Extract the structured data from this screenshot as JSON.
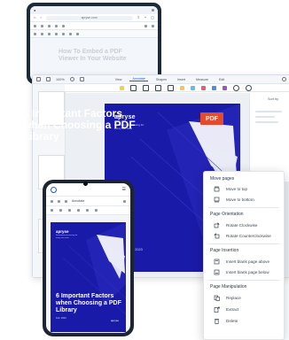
{
  "tablet": {
    "url": "apryse.com",
    "heading": "How To Embed a PDF Viewer In Your Website"
  },
  "desktop": {
    "zoom": "100%",
    "tabs": [
      "View",
      "Annotate",
      "Shapes",
      "Insert",
      "Measure",
      "Edit"
    ],
    "active_tab": "Annotate",
    "sort_label": "Sort by"
  },
  "pdf": {
    "logo": "apryse",
    "subtitle": "Document processing for every use case",
    "title": "6 Important Factors when Choosing a PDF Library",
    "badge": "PDF",
    "date": "May 2023"
  },
  "phone": {
    "url": "Annotate",
    "logo": "apryse",
    "subtitle": "Document processing for every use case",
    "title": "6 Important Factors when Choosing a PDF Library",
    "date": "Feb. 2023",
    "mark": "apryse"
  },
  "context_menu": {
    "sections": [
      {
        "title": "Move pages",
        "items": [
          {
            "label": "Move to top",
            "icon": "move-top-icon"
          },
          {
            "label": "Move to bottom",
            "icon": "move-bottom-icon"
          }
        ]
      },
      {
        "title": "Page Orientation",
        "items": [
          {
            "label": "Rotate Clockwise",
            "icon": "rotate-clockwise-icon"
          },
          {
            "label": "Rotate Counterclockwise",
            "icon": "rotate-counterclockwise-icon"
          }
        ]
      },
      {
        "title": "Page Insertion",
        "items": [
          {
            "label": "Insert blank page above",
            "icon": "insert-above-icon"
          },
          {
            "label": "Insert blank page below",
            "icon": "insert-below-icon"
          }
        ]
      },
      {
        "title": "Page Manipulation",
        "items": [
          {
            "label": "Replace",
            "icon": "replace-icon"
          },
          {
            "label": "Extract",
            "icon": "extract-icon"
          },
          {
            "label": "Delete",
            "icon": "trash-icon"
          }
        ]
      }
    ]
  },
  "colors": {
    "brand_blue": "#1a1aa8",
    "accent": "#1a5dd8",
    "pdf_badge": "#e44a2c"
  }
}
